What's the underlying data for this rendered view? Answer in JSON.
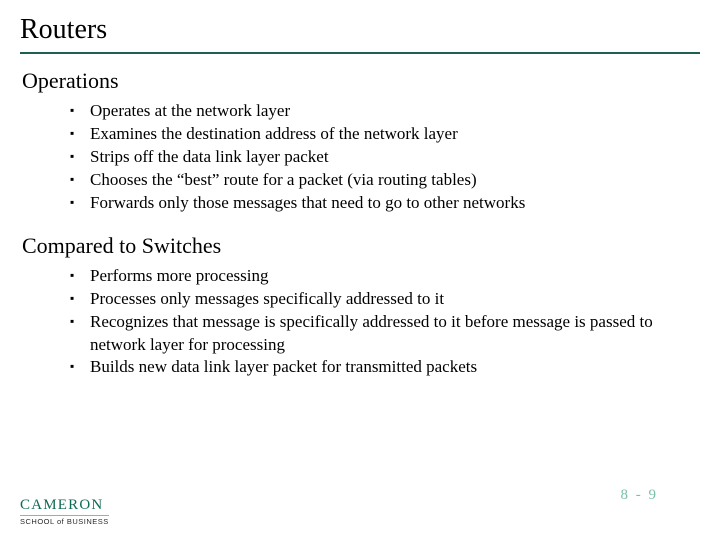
{
  "title": "Routers",
  "sections": [
    {
      "heading": "Operations",
      "items": [
        "Operates at the network layer",
        "Examines the destination address of the network layer",
        "Strips off the data link layer packet",
        "Chooses the “best” route for a packet (via routing tables)",
        "Forwards only those messages that need to go to other networks"
      ]
    },
    {
      "heading": "Compared to Switches",
      "items": [
        "Performs more processing",
        "Processes only messages specifically addressed to it",
        "Recognizes that message is specifically addressed to it before message is passed to network layer for processing",
        "Builds new data link layer packet for transmitted packets"
      ]
    }
  ],
  "logo": {
    "top": "CAMERON",
    "bottom": "SCHOOL of BUSINESS"
  },
  "page_number": "8 - 9"
}
